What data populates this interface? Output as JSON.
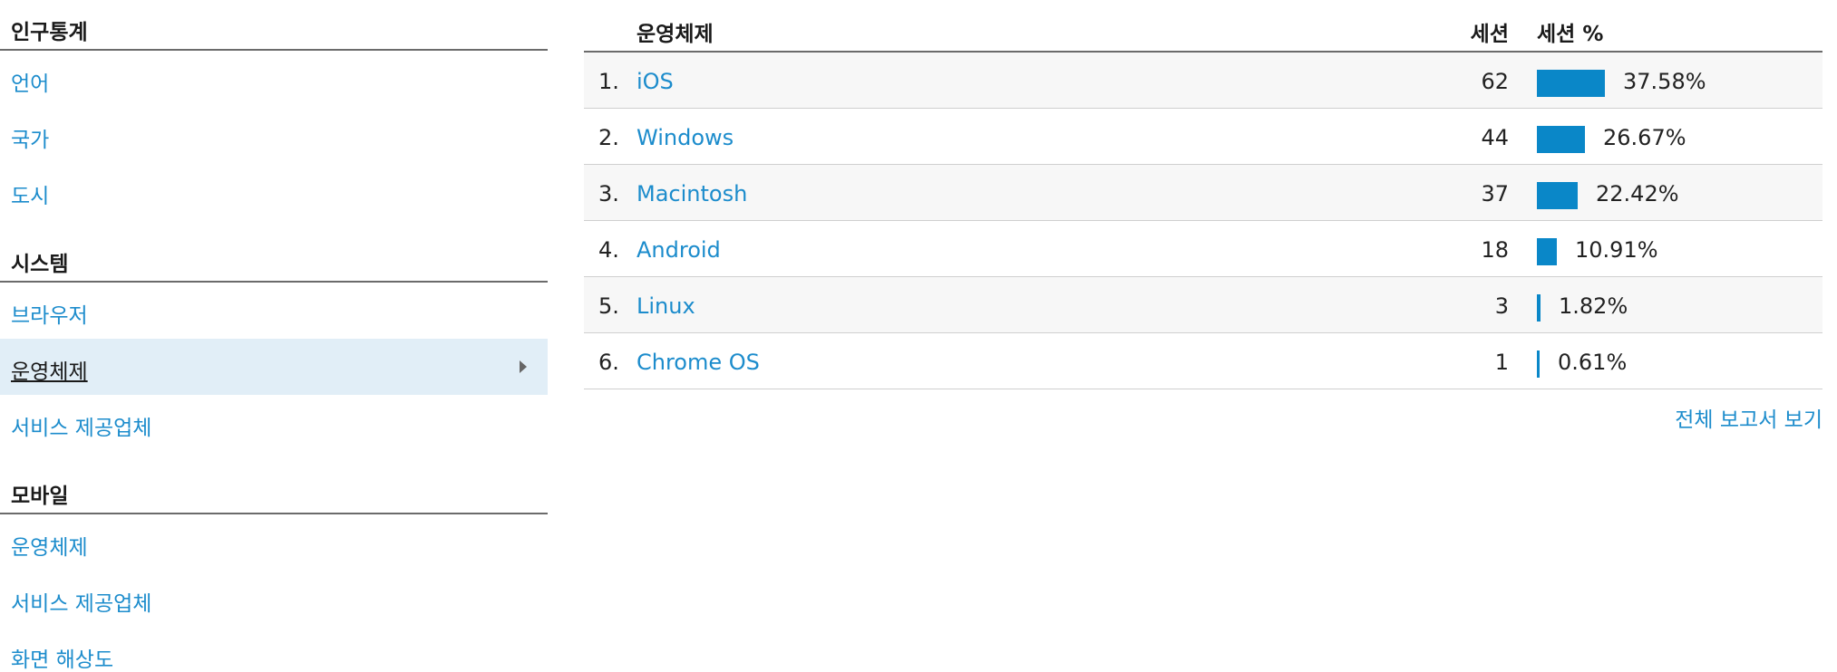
{
  "nav": {
    "sections": [
      {
        "title": "인구통계",
        "items": [
          {
            "label": "언어",
            "active": false
          },
          {
            "label": "국가",
            "active": false
          },
          {
            "label": "도시",
            "active": false
          }
        ]
      },
      {
        "title": "시스템",
        "items": [
          {
            "label": "브라우저",
            "active": false
          },
          {
            "label": "운영체제",
            "active": true
          },
          {
            "label": "서비스 제공업체",
            "active": false
          }
        ]
      },
      {
        "title": "모바일",
        "items": [
          {
            "label": "운영체제",
            "active": false
          },
          {
            "label": "서비스 제공업체",
            "active": false
          },
          {
            "label": "화면 해상도",
            "active": false
          }
        ]
      }
    ]
  },
  "table": {
    "headers": {
      "os": "운영체제",
      "sessions": "세션",
      "percent": "세션 %"
    },
    "rows": [
      {
        "rank": "1.",
        "os": "iOS",
        "sessions": "62",
        "percent_text": "37.58%",
        "percent": 37.58
      },
      {
        "rank": "2.",
        "os": "Windows",
        "sessions": "44",
        "percent_text": "26.67%",
        "percent": 26.67
      },
      {
        "rank": "3.",
        "os": "Macintosh",
        "sessions": "37",
        "percent_text": "22.42%",
        "percent": 22.42
      },
      {
        "rank": "4.",
        "os": "Android",
        "sessions": "18",
        "percent_text": "10.91%",
        "percent": 10.91
      },
      {
        "rank": "5.",
        "os": "Linux",
        "sessions": "3",
        "percent_text": "1.82%",
        "percent": 1.82
      },
      {
        "rank": "6.",
        "os": "Chrome OS",
        "sessions": "1",
        "percent_text": "0.61%",
        "percent": 0.61
      }
    ],
    "full_report_label": "전체 보고서 보기"
  },
  "colors": {
    "link": "#1c8ccc",
    "bar": "#0a87c8",
    "active_bg": "#e1eef7"
  },
  "icons": {
    "active_item_arrow": "caret-right-icon"
  }
}
